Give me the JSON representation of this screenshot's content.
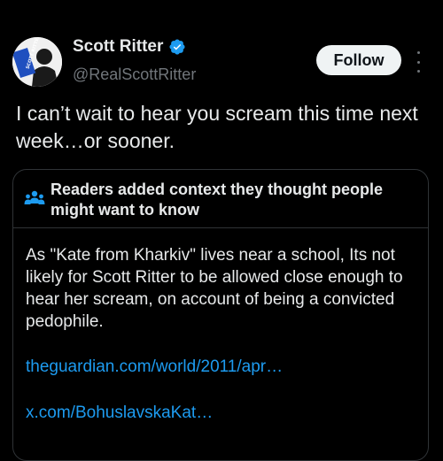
{
  "author": {
    "name": "Scott Ritter",
    "handle": "@RealScottRitter",
    "verified": true,
    "avatar_lettering": "SCOTT RITTER"
  },
  "follow_button": {
    "label": "Follow"
  },
  "tweet": {
    "text": "I can’t wait to hear you scream this time next week…or sooner."
  },
  "community_note": {
    "title": "Readers added context they thought people might want to know",
    "body": "As \"Kate from Kharkiv\" lives near a school, Its not likely for Scott Ritter to be allowed close enough to hear her scream, on account of being a convicted pedophile.",
    "links": [
      "theguardian.com/world/2011/apr…",
      "x.com/BohuslavskaKat…"
    ]
  },
  "icons": {
    "verified": "verified-badge-icon",
    "more": "more-options-icon",
    "note": "people-icon"
  },
  "colors": {
    "background": "#000000",
    "text": "#e7e9ea",
    "secondary_text": "#71767b",
    "link": "#1d9bf0",
    "verified": "#1d9bf0",
    "border": "#2f3336",
    "follow_bg": "#eff3f4"
  }
}
